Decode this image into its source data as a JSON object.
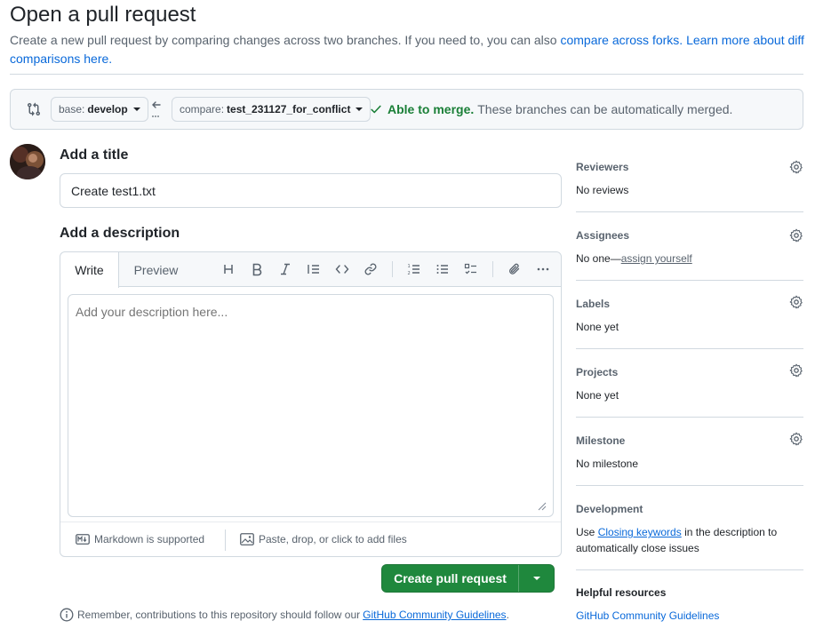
{
  "header": {
    "title": "Open a pull request",
    "subtitle_text": "Create a new pull request by comparing changes across two branches. If you need to, you can also ",
    "subtitle_link1": "compare across forks.",
    "subtitle_link2": "Learn more about diff comparisons here."
  },
  "branch_bar": {
    "base_prefix": "base:",
    "base_branch": "develop",
    "compare_prefix": "compare:",
    "compare_branch": "test_231127_for_conflict",
    "merge_status": "Able to merge.",
    "merge_message": "These branches can be automatically merged."
  },
  "form": {
    "title_label": "Add a title",
    "title_value": "Create test1.txt",
    "description_label": "Add a description",
    "tabs": [
      "Write",
      "Preview"
    ],
    "description_placeholder": "Add your description here...",
    "markdown_note": "Markdown is supported",
    "attach_note": "Paste, drop, or click to add files",
    "submit_label": "Create pull request",
    "remember_text": "Remember, contributions to this repository should follow our",
    "remember_link": "GitHub Community Guidelines",
    "remember_end": "."
  },
  "sidebar": {
    "reviewers": {
      "title": "Reviewers",
      "value": "No reviews"
    },
    "assignees": {
      "title": "Assignees",
      "value_prefix": "No one—",
      "value_link": "assign yourself"
    },
    "labels": {
      "title": "Labels",
      "value": "None yet"
    },
    "projects": {
      "title": "Projects",
      "value": "None yet"
    },
    "milestone": {
      "title": "Milestone",
      "value": "No milestone"
    },
    "development": {
      "title": "Development",
      "text_prefix": "Use ",
      "text_link": "Closing keywords",
      "text_suffix": " in the description to automatically close issues"
    },
    "helpful": {
      "title": "Helpful resources",
      "link": "GitHub Community Guidelines"
    }
  },
  "colors": {
    "accent_link": "#0969da",
    "success": "#1a7f37",
    "primary_button": "#1f883d"
  }
}
